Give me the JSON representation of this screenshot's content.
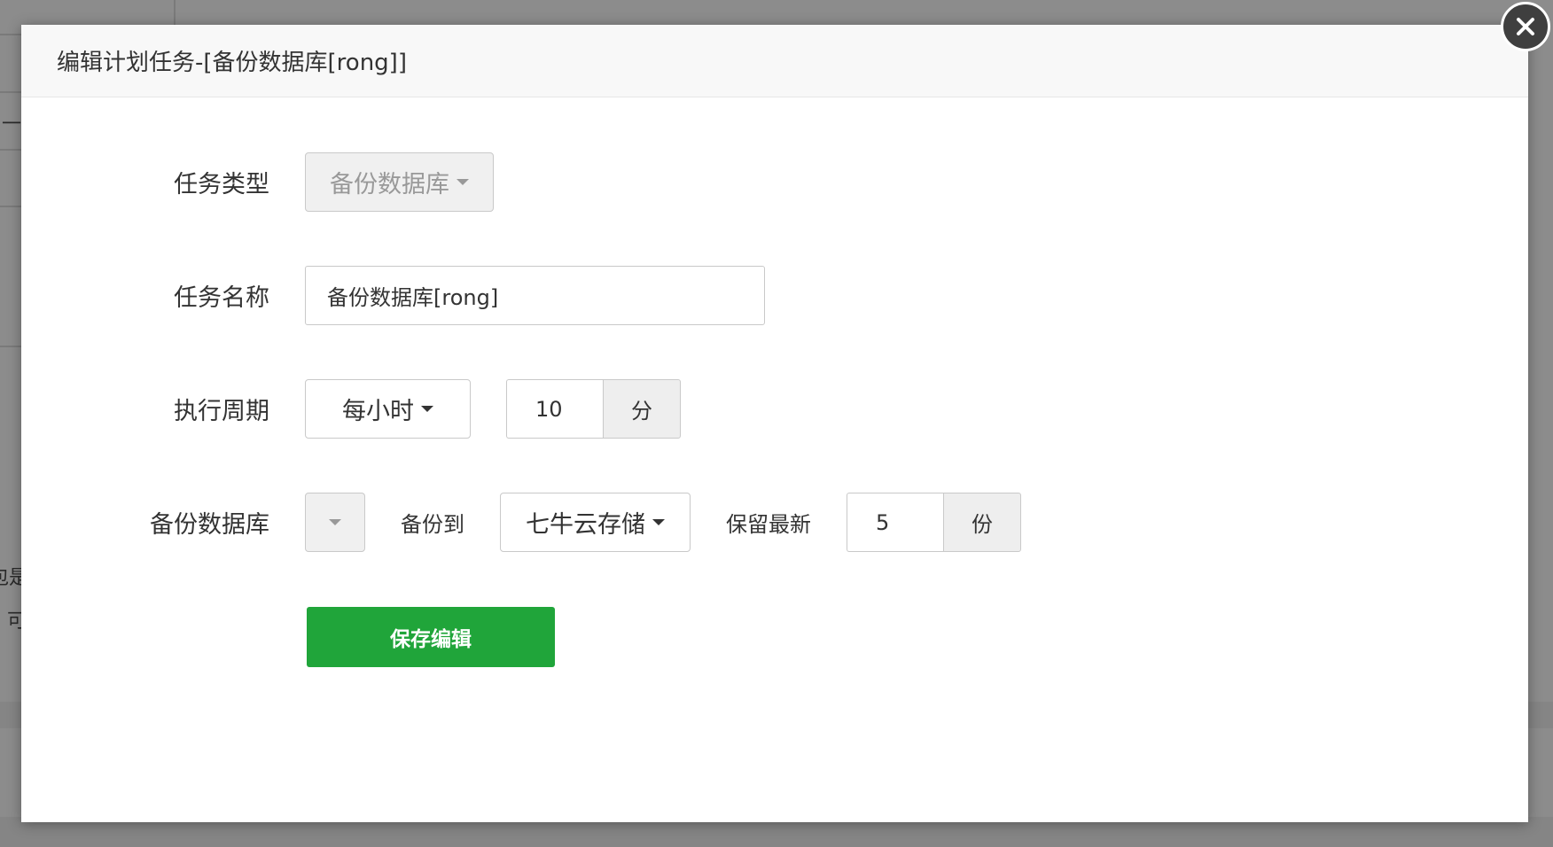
{
  "background": {
    "fragment_1": "一",
    "fragment_2": "包是",
    "fragment_3": "可"
  },
  "modal": {
    "title": "编辑计划任务-[备份数据库[rong]]",
    "close_icon": "close-icon"
  },
  "form": {
    "task_type": {
      "label": "任务类型",
      "value": "备份数据库"
    },
    "task_name": {
      "label": "任务名称",
      "value": "备份数据库[rong]"
    },
    "cycle": {
      "label": "执行周期",
      "period": "每小时",
      "minute_value": "10",
      "minute_unit": "分"
    },
    "backup_db": {
      "label": "备份数据库",
      "db_value": "",
      "backup_to_label": "备份到",
      "backup_to_value": "七牛云存储",
      "keep_label": "保留最新",
      "keep_value": "5",
      "keep_unit": "份"
    },
    "save_label": "保存编辑"
  },
  "colors": {
    "primary": "#20a53a",
    "overlay": "#8c8c8c"
  }
}
